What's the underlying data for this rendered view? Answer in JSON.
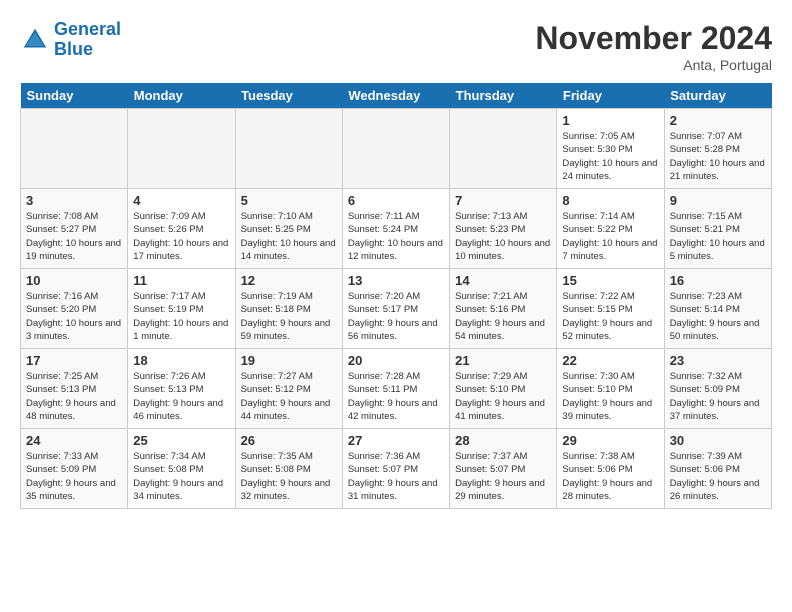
{
  "header": {
    "logo_line1": "General",
    "logo_line2": "Blue",
    "month": "November 2024",
    "location": "Anta, Portugal"
  },
  "days_of_week": [
    "Sunday",
    "Monday",
    "Tuesday",
    "Wednesday",
    "Thursday",
    "Friday",
    "Saturday"
  ],
  "weeks": [
    [
      {
        "day": "",
        "info": ""
      },
      {
        "day": "",
        "info": ""
      },
      {
        "day": "",
        "info": ""
      },
      {
        "day": "",
        "info": ""
      },
      {
        "day": "",
        "info": ""
      },
      {
        "day": "1",
        "info": "Sunrise: 7:05 AM\nSunset: 5:30 PM\nDaylight: 10 hours and 24 minutes."
      },
      {
        "day": "2",
        "info": "Sunrise: 7:07 AM\nSunset: 5:28 PM\nDaylight: 10 hours and 21 minutes."
      }
    ],
    [
      {
        "day": "3",
        "info": "Sunrise: 7:08 AM\nSunset: 5:27 PM\nDaylight: 10 hours and 19 minutes."
      },
      {
        "day": "4",
        "info": "Sunrise: 7:09 AM\nSunset: 5:26 PM\nDaylight: 10 hours and 17 minutes."
      },
      {
        "day": "5",
        "info": "Sunrise: 7:10 AM\nSunset: 5:25 PM\nDaylight: 10 hours and 14 minutes."
      },
      {
        "day": "6",
        "info": "Sunrise: 7:11 AM\nSunset: 5:24 PM\nDaylight: 10 hours and 12 minutes."
      },
      {
        "day": "7",
        "info": "Sunrise: 7:13 AM\nSunset: 5:23 PM\nDaylight: 10 hours and 10 minutes."
      },
      {
        "day": "8",
        "info": "Sunrise: 7:14 AM\nSunset: 5:22 PM\nDaylight: 10 hours and 7 minutes."
      },
      {
        "day": "9",
        "info": "Sunrise: 7:15 AM\nSunset: 5:21 PM\nDaylight: 10 hours and 5 minutes."
      }
    ],
    [
      {
        "day": "10",
        "info": "Sunrise: 7:16 AM\nSunset: 5:20 PM\nDaylight: 10 hours and 3 minutes."
      },
      {
        "day": "11",
        "info": "Sunrise: 7:17 AM\nSunset: 5:19 PM\nDaylight: 10 hours and 1 minute."
      },
      {
        "day": "12",
        "info": "Sunrise: 7:19 AM\nSunset: 5:18 PM\nDaylight: 9 hours and 59 minutes."
      },
      {
        "day": "13",
        "info": "Sunrise: 7:20 AM\nSunset: 5:17 PM\nDaylight: 9 hours and 56 minutes."
      },
      {
        "day": "14",
        "info": "Sunrise: 7:21 AM\nSunset: 5:16 PM\nDaylight: 9 hours and 54 minutes."
      },
      {
        "day": "15",
        "info": "Sunrise: 7:22 AM\nSunset: 5:15 PM\nDaylight: 9 hours and 52 minutes."
      },
      {
        "day": "16",
        "info": "Sunrise: 7:23 AM\nSunset: 5:14 PM\nDaylight: 9 hours and 50 minutes."
      }
    ],
    [
      {
        "day": "17",
        "info": "Sunrise: 7:25 AM\nSunset: 5:13 PM\nDaylight: 9 hours and 48 minutes."
      },
      {
        "day": "18",
        "info": "Sunrise: 7:26 AM\nSunset: 5:13 PM\nDaylight: 9 hours and 46 minutes."
      },
      {
        "day": "19",
        "info": "Sunrise: 7:27 AM\nSunset: 5:12 PM\nDaylight: 9 hours and 44 minutes."
      },
      {
        "day": "20",
        "info": "Sunrise: 7:28 AM\nSunset: 5:11 PM\nDaylight: 9 hours and 42 minutes."
      },
      {
        "day": "21",
        "info": "Sunrise: 7:29 AM\nSunset: 5:10 PM\nDaylight: 9 hours and 41 minutes."
      },
      {
        "day": "22",
        "info": "Sunrise: 7:30 AM\nSunset: 5:10 PM\nDaylight: 9 hours and 39 minutes."
      },
      {
        "day": "23",
        "info": "Sunrise: 7:32 AM\nSunset: 5:09 PM\nDaylight: 9 hours and 37 minutes."
      }
    ],
    [
      {
        "day": "24",
        "info": "Sunrise: 7:33 AM\nSunset: 5:09 PM\nDaylight: 9 hours and 35 minutes."
      },
      {
        "day": "25",
        "info": "Sunrise: 7:34 AM\nSunset: 5:08 PM\nDaylight: 9 hours and 34 minutes."
      },
      {
        "day": "26",
        "info": "Sunrise: 7:35 AM\nSunset: 5:08 PM\nDaylight: 9 hours and 32 minutes."
      },
      {
        "day": "27",
        "info": "Sunrise: 7:36 AM\nSunset: 5:07 PM\nDaylight: 9 hours and 31 minutes."
      },
      {
        "day": "28",
        "info": "Sunrise: 7:37 AM\nSunset: 5:07 PM\nDaylight: 9 hours and 29 minutes."
      },
      {
        "day": "29",
        "info": "Sunrise: 7:38 AM\nSunset: 5:06 PM\nDaylight: 9 hours and 28 minutes."
      },
      {
        "day": "30",
        "info": "Sunrise: 7:39 AM\nSunset: 5:06 PM\nDaylight: 9 hours and 26 minutes."
      }
    ]
  ]
}
